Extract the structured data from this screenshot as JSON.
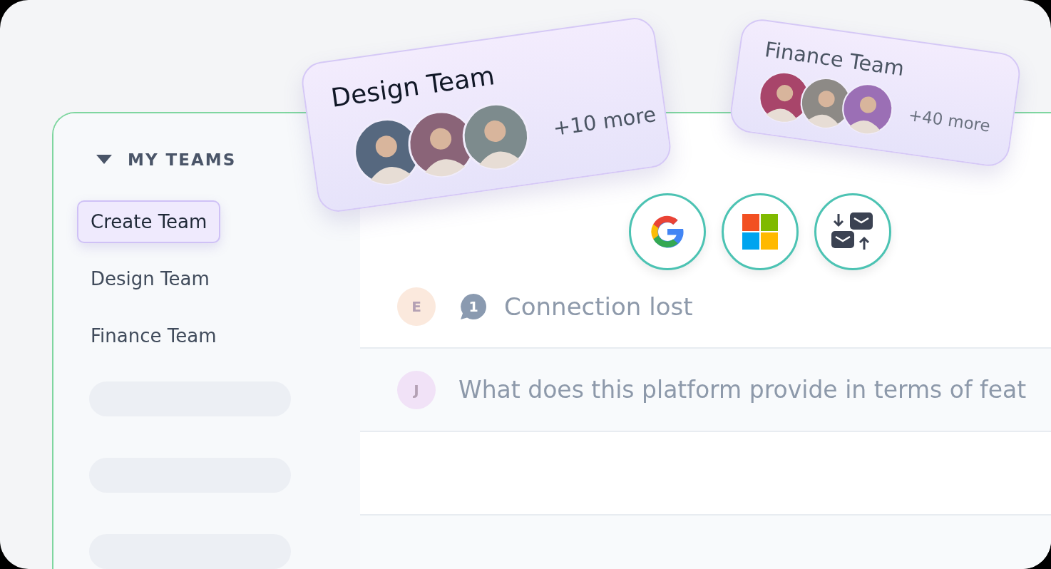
{
  "team_cards": [
    {
      "title": "Design Team",
      "kind": "large",
      "avatars": [
        {
          "color": "#56687f"
        },
        {
          "color": "#8a6478"
        },
        {
          "color": "#7d8b8d"
        }
      ],
      "more": "+10 more"
    },
    {
      "title": "Finance Team",
      "kind": "small",
      "avatars": [
        {
          "color": "#a8456a"
        },
        {
          "color": "#8d8a86"
        },
        {
          "color": "#9b6fb5"
        }
      ],
      "more": "+40 more"
    }
  ],
  "sidebar": {
    "heading": "MY TEAMS",
    "expanded": true,
    "items": [
      {
        "label": "Create Team",
        "selected": true
      },
      {
        "label": "Design Team",
        "selected": false
      },
      {
        "label": "Finance Team",
        "selected": false
      }
    ],
    "placeholders": [
      {
        "kind": "skeleton"
      },
      {
        "kind": "skeleton"
      },
      {
        "kind": "skeleton"
      }
    ]
  },
  "integrations": [
    {
      "kind": "google"
    },
    {
      "kind": "microsoft"
    },
    {
      "kind": "swap"
    }
  ],
  "messages": [
    {
      "initial": "E",
      "color": "#fbe9dd",
      "badge": "1",
      "text": "Connection lost"
    },
    {
      "initial": "J",
      "color": "#f1e2f7",
      "text": "What does this platform provide in terms of feat"
    }
  ]
}
